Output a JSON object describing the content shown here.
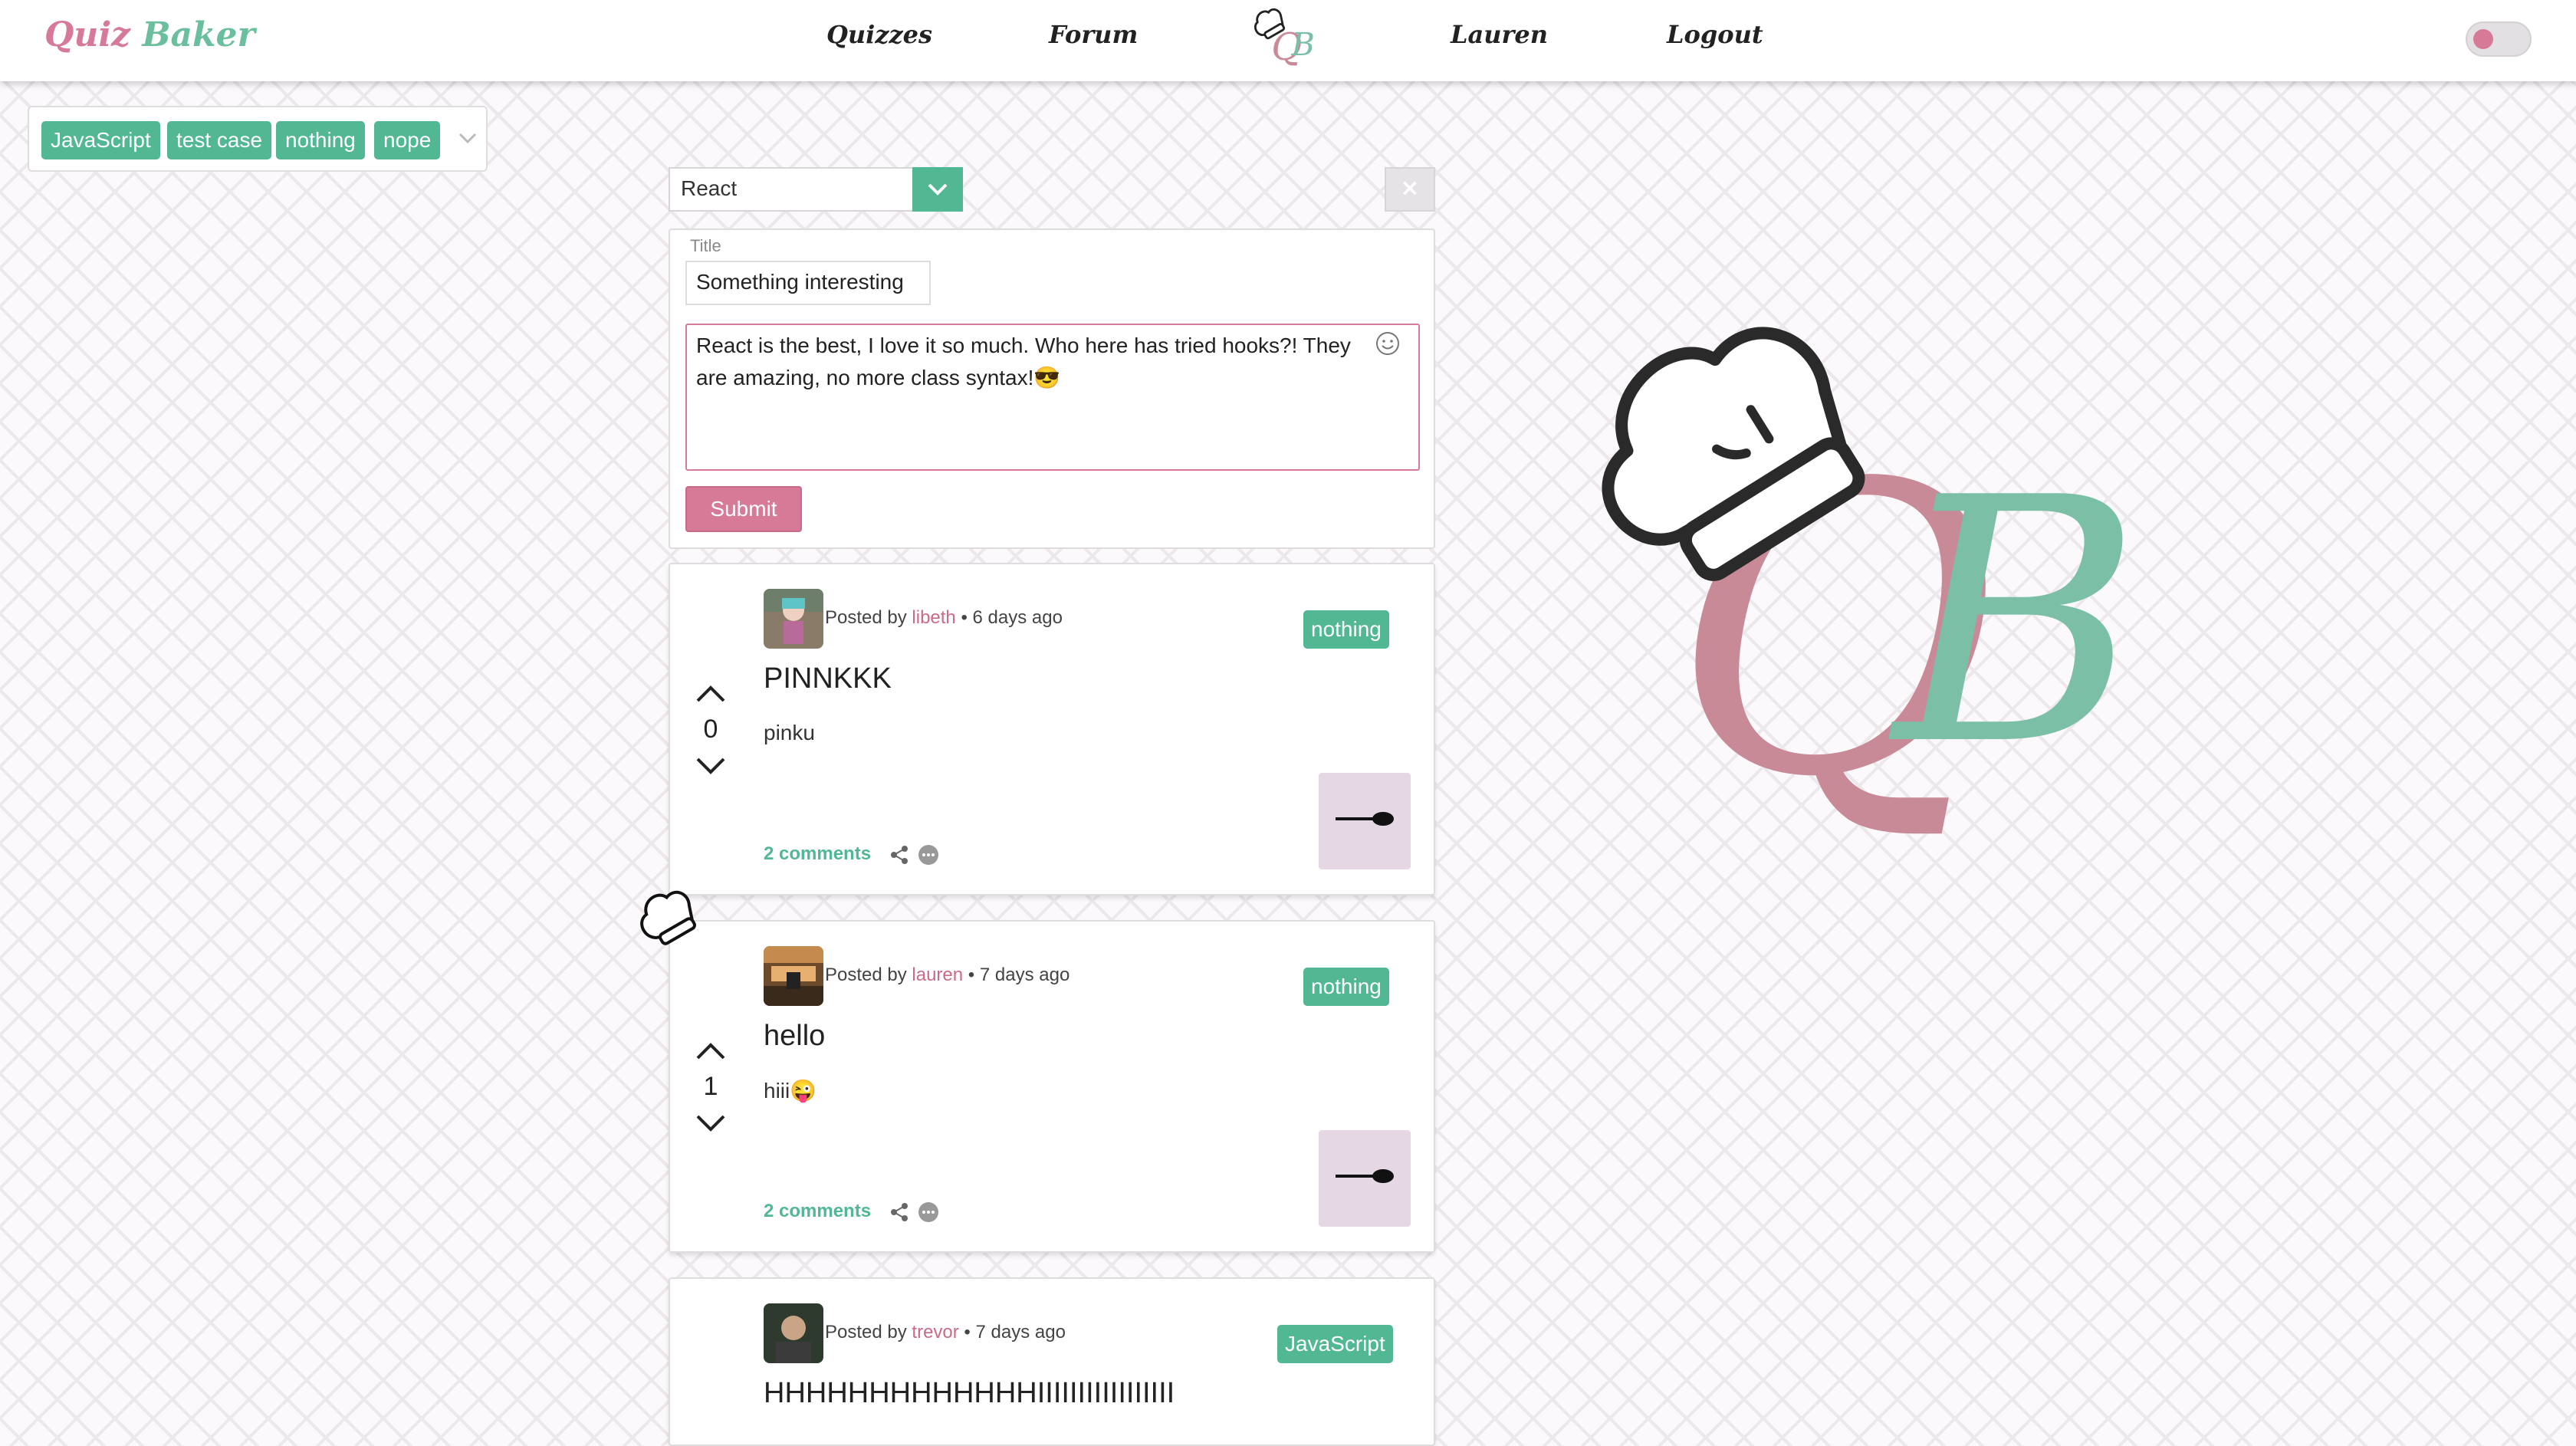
{
  "app": {
    "brand_part1": "Quiz ",
    "brand_part2": "Baker",
    "logo_text_q": "Q",
    "logo_text_b": "B"
  },
  "nav": {
    "quizzes": "Quizzes",
    "forum": "Forum",
    "user": "Lauren",
    "logout": "Logout"
  },
  "filter": {
    "tags": [
      "JavaScript",
      "test case",
      "nothing",
      "nope"
    ]
  },
  "form": {
    "category": "React",
    "close_label": "×",
    "title_label": "Title",
    "title_value": "Something interesting",
    "body_value": "React is the best, I love it so much. Who here has tried hooks?! They are amazing, no more class syntax!😎",
    "submit_label": "Submit"
  },
  "posts": [
    {
      "posted_by": "Posted by ",
      "author": "libeth",
      "age": " • 6 days ago",
      "tag": "nothing",
      "title": "PINNKKK",
      "body": "pinku",
      "votes": "0",
      "comments": "2 comments"
    },
    {
      "posted_by": "Posted by ",
      "author": "lauren",
      "age": " • 7 days ago",
      "tag": "nothing",
      "title": "hello",
      "body": "hiii😜",
      "votes": "1",
      "comments": "2 comments"
    },
    {
      "posted_by": "Posted by ",
      "author": "trevor",
      "age": " • 7 days ago",
      "tag": "JavaScript",
      "title": "HHHHHHHHHHHHHIIIIIIIIIIIIIIIII",
      "body": "",
      "votes": "",
      "comments": ""
    }
  ],
  "colors": {
    "pink": "#d67a97",
    "green": "#52b793",
    "logo_pink": "#c98a98",
    "logo_green": "#7cbfa7"
  },
  "icons": [
    "chef-hat-icon",
    "chevron-down-icon",
    "close-icon",
    "smiley-icon",
    "arrow-up-icon",
    "arrow-down-icon",
    "share-icon",
    "more-icon",
    "spoon-icon"
  ]
}
